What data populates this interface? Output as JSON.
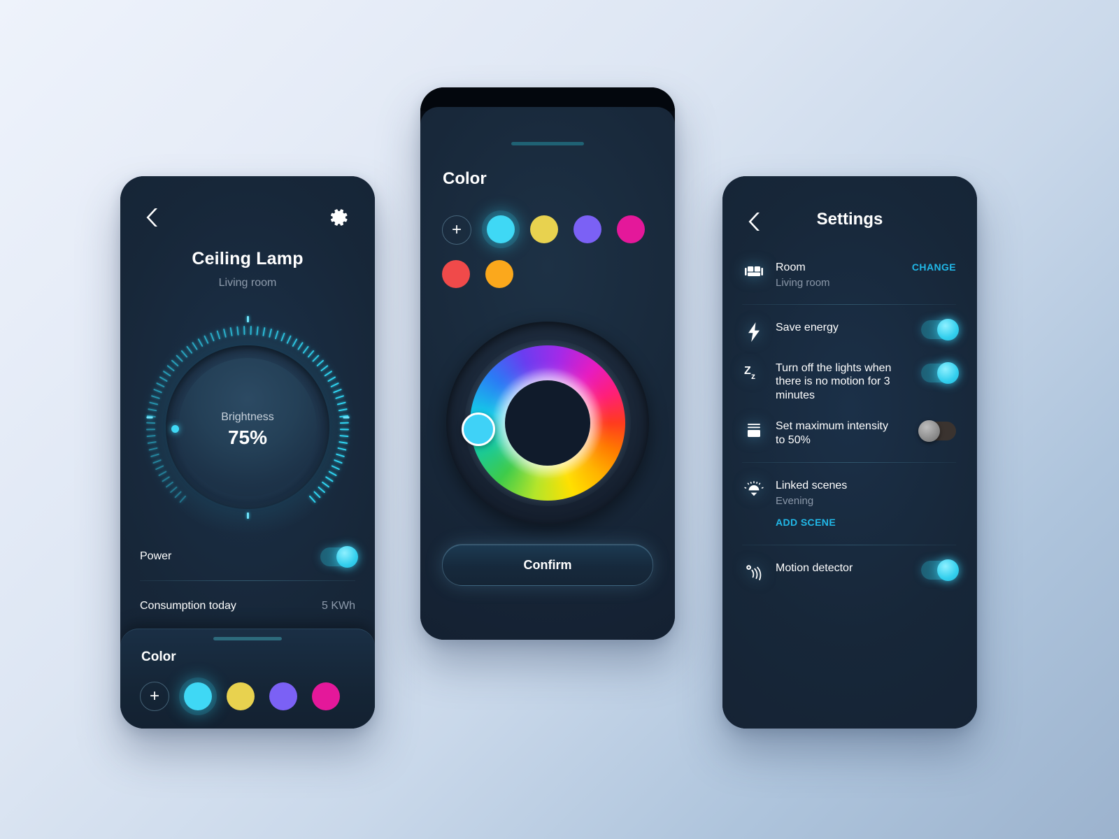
{
  "theme": {
    "accent": "#21b8e8",
    "cyan": "#3fd8f5",
    "screen_bg": "#152336",
    "page_bg_start": "#eef3fb",
    "page_bg_end": "#9cb3ce"
  },
  "lamp_screen": {
    "back_icon": "chevron-left-icon",
    "settings_icon": "gear-icon",
    "title": "Ceiling Lamp",
    "subtitle": "Living room",
    "dial": {
      "label": "Brightness",
      "value": "75%",
      "percent": 75
    },
    "power_row": {
      "label": "Power",
      "toggle_on": true
    },
    "consumption_row": {
      "label": "Consumption today",
      "value": "5 KWh"
    },
    "color_card": {
      "title": "Color",
      "add_label": "+",
      "swatches": [
        {
          "name": "cyan",
          "hex": "#3fd8f5",
          "selected": true
        },
        {
          "name": "yellow",
          "hex": "#e8d24f",
          "selected": false
        },
        {
          "name": "purple",
          "hex": "#7b61f5",
          "selected": false
        },
        {
          "name": "magenta",
          "hex": "#e4189a",
          "selected": false
        }
      ]
    }
  },
  "color_screen": {
    "title": "Color",
    "add_label": "+",
    "swatches": [
      {
        "name": "cyan",
        "hex": "#3fd8f5",
        "selected": true
      },
      {
        "name": "yellow",
        "hex": "#e8d24f",
        "selected": false
      },
      {
        "name": "purple",
        "hex": "#7b61f5",
        "selected": false
      },
      {
        "name": "magenta",
        "hex": "#e4189a",
        "selected": false
      },
      {
        "name": "red",
        "hex": "#f04a4a",
        "selected": false
      },
      {
        "name": "orange",
        "hex": "#fba81c",
        "selected": false
      }
    ],
    "wheel": {
      "selected_hex": "#3fd2f7"
    },
    "confirm_label": "Confirm"
  },
  "settings_screen": {
    "back_icon": "chevron-left-icon",
    "title": "Settings",
    "items": [
      {
        "icon": "sofa-icon",
        "title": "Room",
        "subtitle": "Living room",
        "action": "CHANGE",
        "control": "link"
      },
      {
        "icon": "bolt-icon",
        "title": "Save energy",
        "subtitle": "",
        "control": "toggle",
        "toggle_on": true
      },
      {
        "icon": "zzz-icon",
        "title": "Turn off the lights when there is no motion for 3 minutes",
        "subtitle": "",
        "control": "toggle",
        "toggle_on": true
      },
      {
        "icon": "intensity-icon",
        "title": "Set maximum intensity to 50%",
        "subtitle": "",
        "control": "toggle",
        "toggle_on": false
      },
      {
        "icon": "sunset-icon",
        "title": "Linked scenes",
        "subtitle": "Evening",
        "action": "ADD SCENE",
        "control": "link-below"
      },
      {
        "icon": "motion-icon",
        "title": "Motion detector",
        "subtitle": "",
        "control": "toggle",
        "toggle_on": true
      }
    ]
  }
}
